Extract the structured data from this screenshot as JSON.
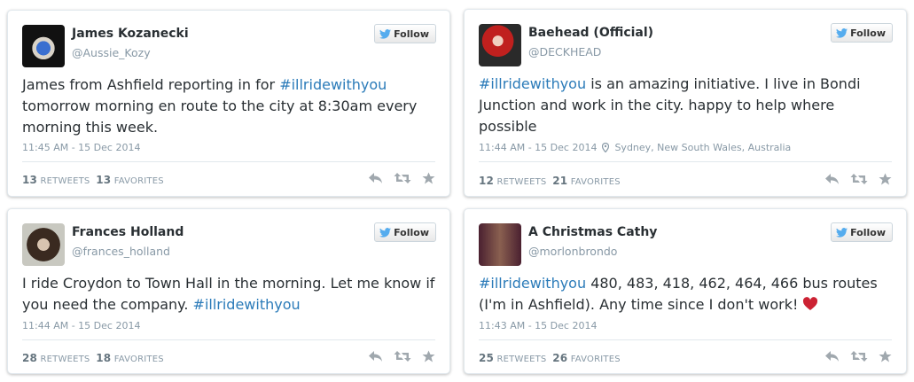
{
  "follow_label": "Follow",
  "retweets_label": "RETWEETS",
  "favorites_label": "FAVORITES",
  "colors": {
    "link": "#2b7bb9",
    "twitter_blue": "#55acee",
    "heart": "#cc2233"
  },
  "tweets": [
    {
      "name": "James Kozanecki",
      "handle": "@Aussie_Kozy",
      "text_before": "James from Ashfield reporting in for ",
      "hashtag": "#illridewithyou",
      "text_after": " tomorrow morning en route to the city at 8:30am every morning this week.",
      "timestamp": "11:45 AM - 15 Dec 2014",
      "retweets": "13",
      "favorites": "13"
    },
    {
      "name": "Baehead (Official)",
      "handle": "@DECKHEAD",
      "text_before": "",
      "hashtag": "#illridewithyou",
      "text_after": " is an amazing initiative. I live in Bondi Junction and work in the city. happy to help where possible",
      "timestamp": "11:44 AM - 15 Dec 2014",
      "location": "Sydney, New South Wales, Australia",
      "retweets": "12",
      "favorites": "21"
    },
    {
      "name": "Frances Holland",
      "handle": "@frances_holland",
      "text_before": "I ride Croydon to Town Hall in the morning. Let me know if you need the company. ",
      "hashtag": "#illridewithyou",
      "text_after": "",
      "timestamp": "11:44 AM - 15 Dec 2014",
      "retweets": "28",
      "favorites": "18"
    },
    {
      "name": "A Christmas Cathy",
      "handle": "@morlonbrondo",
      "text_before": "",
      "hashtag": "#illridewithyou",
      "text_after": " 480, 483, 418, 462, 464, 466 bus routes (I'm in Ashfield). Any time since I don't work! ",
      "timestamp": "11:43 AM - 15 Dec 2014",
      "retweets": "25",
      "favorites": "26"
    }
  ]
}
